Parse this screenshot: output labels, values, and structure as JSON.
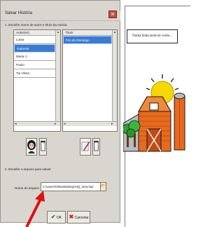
{
  "dialog": {
    "title": "Salvar História",
    "close_glyph": "✕",
    "section1_label": "1. Escolhe nome de autor e título da notícia",
    "list1": {
      "header": "Autor(es)",
      "items": [
        "Luísa",
        "Gabriela",
        "Maria J.",
        "Paulo",
        "Tia Vilma"
      ],
      "selected_index": 1
    },
    "list2": {
      "header": "Título",
      "items": [
        "Fim do Domingo"
      ],
      "selected_index": 0
    },
    "section2_label": "2. Escolhe o arquivo para salvar",
    "file_field_label": "Nome do arquivo",
    "file_path": "C:\\Users\\Vilma\\Desktop\\HQ_Vera.hqz",
    "ok_label": "OK",
    "cancel_label": "Cancelar"
  },
  "story": {
    "caption": "Numa linda tarde de verão..."
  },
  "colors": {
    "selection": "#3a7bd5",
    "ok_check": "#1f8f1f",
    "cancel_x": "#c0281c",
    "arrow": "#e01010",
    "barn": "#e86a1e",
    "sun": "#f5d800"
  }
}
